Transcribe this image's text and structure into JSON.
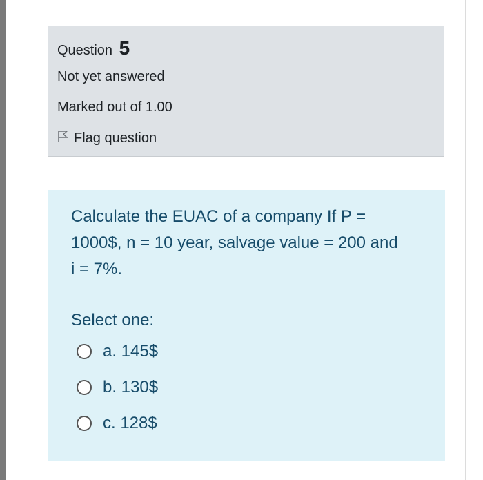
{
  "question": {
    "label": "Question",
    "number": "5",
    "state": "Not yet answered",
    "grade": "Marked out of 1.00",
    "flag_label": "Flag question"
  },
  "content": {
    "text_lines": [
      "Calculate the EUAC of a company If P =",
      "1000$, n = 10 year, salvage value = 200 and",
      "i = 7%."
    ],
    "prompt": "Select one:",
    "options": [
      {
        "label": "a. 145$"
      },
      {
        "label": "b. 130$"
      },
      {
        "label": "c. 128$"
      }
    ]
  },
  "icons": {
    "flag": "flag-icon"
  }
}
